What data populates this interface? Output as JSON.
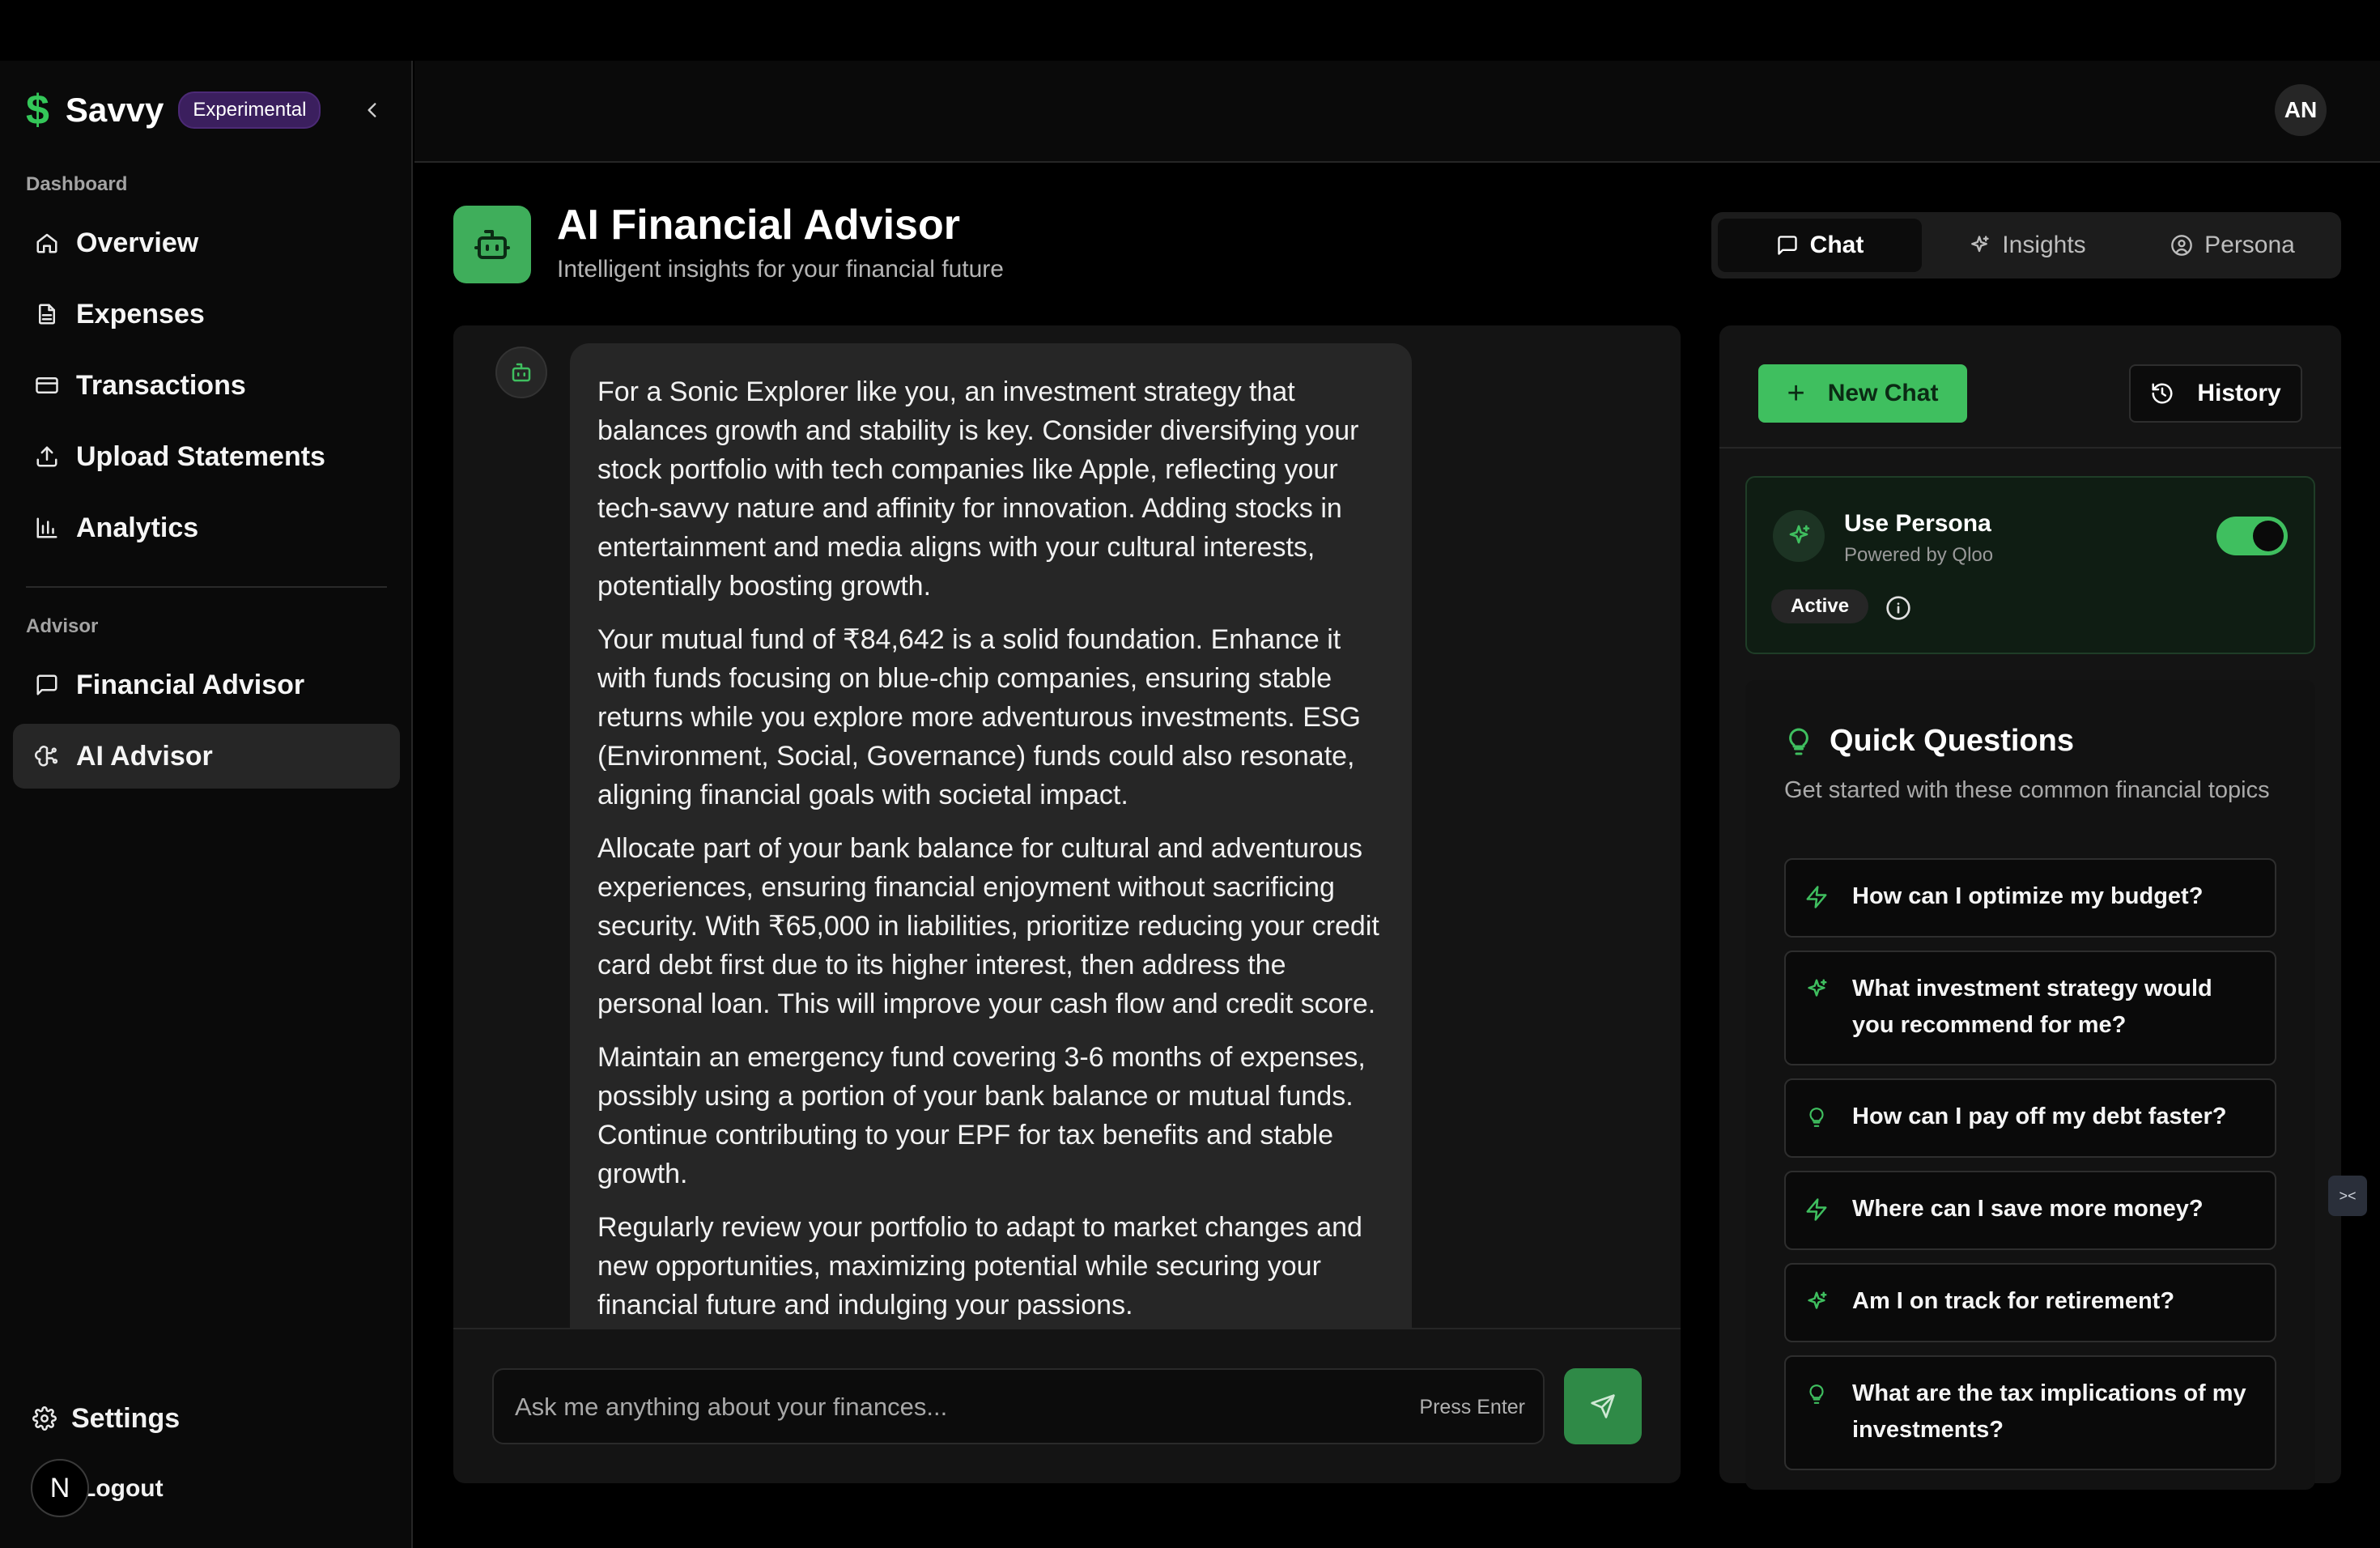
{
  "brand": {
    "name": "Savvy",
    "badge": "Experimental"
  },
  "sidebar": {
    "dashboard_label": "Dashboard",
    "dashboard_items": [
      {
        "label": "Overview",
        "icon": "home-icon"
      },
      {
        "label": "Expenses",
        "icon": "document-icon"
      },
      {
        "label": "Transactions",
        "icon": "credit-card-icon"
      },
      {
        "label": "Upload Statements",
        "icon": "upload-icon"
      },
      {
        "label": "Analytics",
        "icon": "bar-chart-icon"
      }
    ],
    "advisor_label": "Advisor",
    "advisor_items": [
      {
        "label": "Financial Advisor",
        "icon": "message-square-icon"
      },
      {
        "label": "AI Advisor",
        "icon": "brain-circuit-icon",
        "active": true
      }
    ],
    "settings_label": "Settings",
    "logout_label": "Logout",
    "n_badge": "N"
  },
  "header": {
    "avatar_initials": "AN"
  },
  "page": {
    "title": "AI Financial Advisor",
    "subtitle": "Intelligent insights for your financial future"
  },
  "tabs": [
    {
      "label": "Chat",
      "active": true
    },
    {
      "label": "Insights",
      "active": false
    },
    {
      "label": "Persona",
      "active": false
    }
  ],
  "chat": {
    "messages": [
      {
        "role": "assistant",
        "paragraphs": [
          "For a Sonic Explorer like you, an investment strategy that balances growth and stability is key. Consider diversifying your stock portfolio with tech companies like Apple, reflecting your tech-savvy nature and affinity for innovation. Adding stocks in entertainment and media aligns with your cultural interests, potentially boosting growth.",
          "Your mutual fund of ₹84,642 is a solid foundation. Enhance it with funds focusing on blue-chip companies, ensuring stable returns while you explore more adventurous investments. ESG (Environment, Social, Governance) funds could also resonate, aligning financial goals with societal impact.",
          "Allocate part of your bank balance for cultural and adventurous experiences, ensuring financial enjoyment without sacrificing security. With ₹65,000 in liabilities, prioritize reducing your credit card debt first due to its higher interest, then address the personal loan. This will improve your cash flow and credit score.",
          "Maintain an emergency fund covering 3-6 months of expenses, possibly using a portion of your bank balance or mutual funds. Continue contributing to your EPF for tax benefits and stable growth.",
          "Regularly review your portfolio to adapt to market changes and new opportunities, maximizing potential while securing your financial future and indulging your passions."
        ]
      }
    ],
    "input_placeholder": "Ask me anything about your finances...",
    "input_value": "",
    "press_enter": "Press Enter"
  },
  "right": {
    "new_chat_label": "New Chat",
    "history_label": "History",
    "persona": {
      "title": "Use Persona",
      "subtitle": "Powered by Qloo",
      "enabled": true,
      "status": "Active"
    },
    "quick_questions": {
      "title": "Quick Questions",
      "subtitle": "Get started with these common financial topics",
      "items": [
        {
          "text": "How can I optimize my budget?",
          "icon": "zap-icon"
        },
        {
          "text": "What investment strategy would you recommend for me?",
          "icon": "sparkles-icon"
        },
        {
          "text": "How can I pay off my debt faster?",
          "icon": "lightbulb-icon"
        },
        {
          "text": "Where can I save more money?",
          "icon": "zap-icon"
        },
        {
          "text": "Am I on track for retirement?",
          "icon": "sparkles-icon"
        },
        {
          "text": "What are the tax implications of my investments?",
          "icon": "lightbulb-icon"
        }
      ]
    }
  },
  "colors": {
    "accent": "#3fbf5f",
    "brand_badge": "#3b1f5e",
    "background": "#000000"
  }
}
